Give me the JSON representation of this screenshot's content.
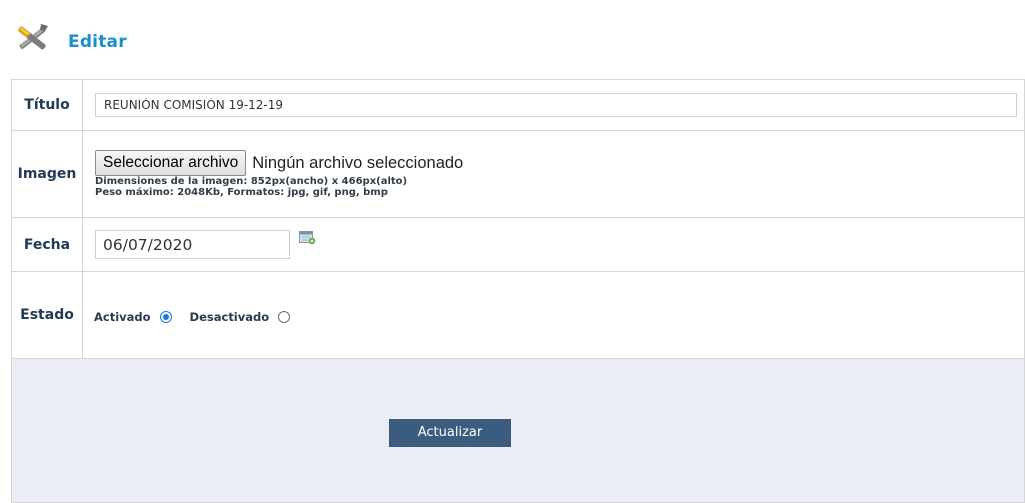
{
  "header": {
    "title": "Editar",
    "icon": "tools-icon"
  },
  "form": {
    "titulo": {
      "label": "Título",
      "value": "REUNIÓN COMISIÓN 19-12-19"
    },
    "imagen": {
      "label": "Imagen",
      "button_label": "Seleccionar archivo",
      "status": "Ningún archivo seleccionado",
      "hint_line1": "Dimensiones de la imagen: 852px(ancho) x 466px(alto)",
      "hint_line2": "Peso máximo: 2048Kb, Formatos: jpg, gif, png, bmp"
    },
    "fecha": {
      "label": "Fecha",
      "value": "06/07/2020",
      "icon": "calendar-icon"
    },
    "estado": {
      "label": "Estado",
      "options": [
        {
          "label": "Activado",
          "selected": true
        },
        {
          "label": "Desactivado",
          "selected": false
        }
      ]
    },
    "submit_label": "Actualizar"
  },
  "colors": {
    "title": "#1a8fcf",
    "button": "#3c5c7f",
    "footer_bg": "#eaeef4",
    "radio_selected": "#1a73e8"
  }
}
